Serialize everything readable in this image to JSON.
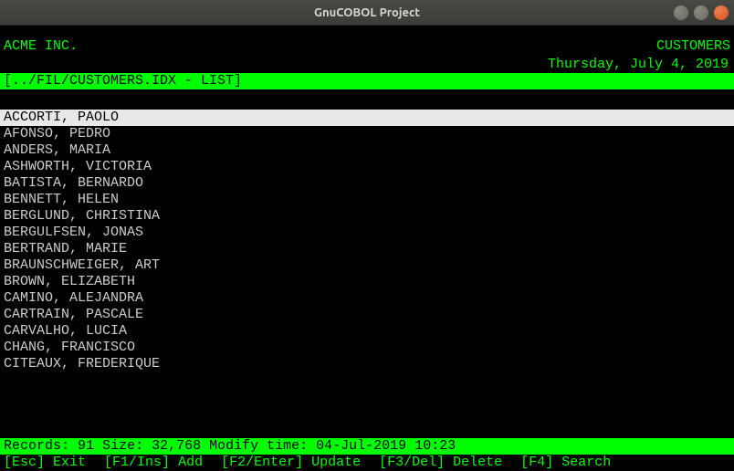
{
  "window": {
    "title": "GnuCOBOL Project"
  },
  "header": {
    "company": "ACME INC.",
    "screen": "CUSTOMERS",
    "date": "Thursday, July 4, 2019"
  },
  "path_bar": "[../FIL/CUSTOMERS.IDX - LIST]",
  "list": {
    "selected_index": 0,
    "rows": [
      "ACCORTI, PAOLO",
      "AFONSO, PEDRO",
      "ANDERS, MARIA",
      "ASHWORTH, VICTORIA",
      "BATISTA, BERNARDO",
      "BENNETT, HELEN",
      "BERGLUND, CHRISTINA",
      "BERGULFSEN, JONAS",
      "BERTRAND, MARIE",
      "BRAUNSCHWEIGER, ART",
      "BROWN, ELIZABETH",
      "CAMINO, ALEJANDRA",
      "CARTRAIN, PASCALE",
      "CARVALHO, LUCIA",
      "CHANG, FRANCISCO",
      "CITEAUX, FREDERIQUE"
    ]
  },
  "status": {
    "records_label": "Records:",
    "records": "91",
    "size_label": "Size:",
    "size": "32,768",
    "modify_label": "Modify time:",
    "modify": "04-Jul-2019 10:23"
  },
  "fkeys": [
    {
      "key": "[Esc]",
      "label": "Exit"
    },
    {
      "key": "[F1/Ins]",
      "label": "Add"
    },
    {
      "key": "[F2/Enter]",
      "label": "Update"
    },
    {
      "key": "[F3/Del]",
      "label": "Delete"
    },
    {
      "key": "[F4]",
      "label": "Search"
    }
  ]
}
